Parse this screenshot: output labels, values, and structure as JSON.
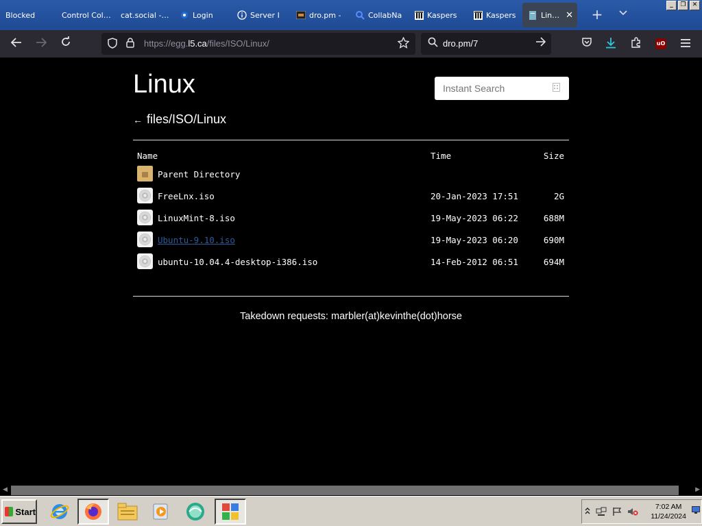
{
  "browser": {
    "tabs": [
      {
        "label": "Blocked",
        "icon": "none"
      },
      {
        "label": "Control Collab",
        "icon": "none"
      },
      {
        "label": "cat.social - Th",
        "icon": "none"
      },
      {
        "label": "Login",
        "icon": "login-icon"
      },
      {
        "label": "Server I",
        "icon": "info-icon"
      },
      {
        "label": "dro.pm -",
        "icon": "dropm-icon"
      },
      {
        "label": "CollabNa",
        "icon": "search-icon"
      },
      {
        "label": "Kaspers",
        "icon": "kaspersky-icon"
      },
      {
        "label": "Kaspers",
        "icon": "kaspersky-icon"
      },
      {
        "label": "Linux",
        "icon": "page-icon",
        "active": true
      }
    ],
    "new_tab": "+",
    "url": {
      "prefix": "https://egg.",
      "host": "l5.ca",
      "path": "/files/ISO/Linux/"
    },
    "search_value": "dro.pm/7"
  },
  "page": {
    "title": "Linux",
    "search_placeholder": "Instant Search",
    "breadcrumb_arrow": "←",
    "breadcrumb": "files/ISO/Linux",
    "columns": {
      "name": "Name",
      "time": "Time",
      "size": "Size"
    },
    "entries": [
      {
        "name": "Parent Directory",
        "time": "",
        "size": "",
        "type": "folder"
      },
      {
        "name": "FreeLnx.iso",
        "time": "20-Jan-2023 17:51",
        "size": "2G",
        "type": "iso"
      },
      {
        "name": "LinuxMint-8.iso",
        "time": "19-May-2023 06:22",
        "size": "688M",
        "type": "iso"
      },
      {
        "name": "Ubuntu-9.10.iso",
        "time": "19-May-2023 06:20",
        "size": "690M",
        "type": "iso",
        "visited": true
      },
      {
        "name": "ubuntu-10.04.4-desktop-i386.iso",
        "time": "14-Feb-2012 06:51",
        "size": "694M",
        "type": "iso"
      }
    ],
    "footer": "Takedown requests: marbler(at)kevinthe(dot)horse"
  },
  "taskbar": {
    "start_label": "Start",
    "apps": [
      "internet-explorer-icon",
      "firefox-icon",
      "file-explorer-icon",
      "media-player-icon",
      "messenger-icon",
      "puzzle-app-icon"
    ],
    "time": "7:02 AM",
    "date": "11/24/2024"
  }
}
